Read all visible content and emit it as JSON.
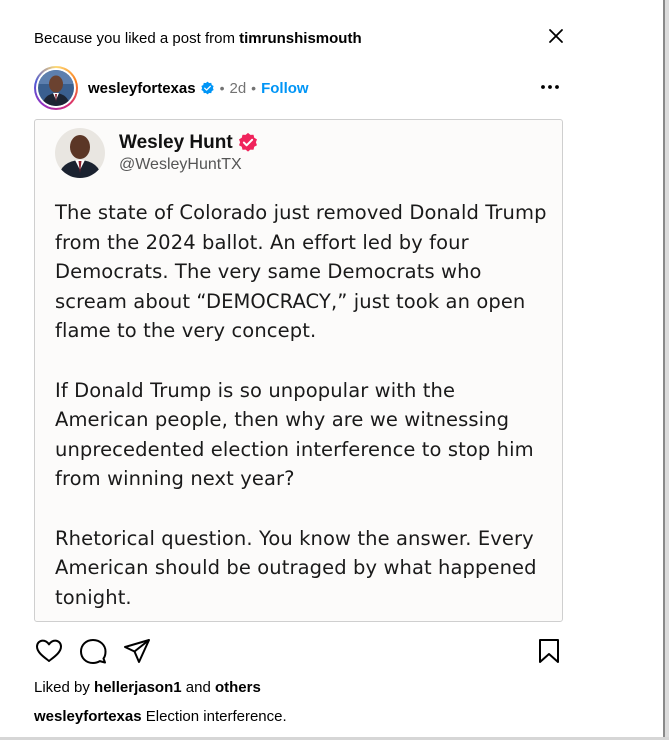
{
  "suggestion": {
    "prefix": "Because you liked a post from ",
    "username": "timrunshismouth"
  },
  "post": {
    "username": "wesleyfortexas",
    "separator": "•",
    "time_ago": "2d",
    "follow_label": "Follow"
  },
  "tweet": {
    "name": "Wesley Hunt",
    "handle": "@WesleyHuntTX",
    "paragraphs": [
      "The state of Colorado just removed Donald Trump from the 2024 ballot. An effort led by four Democrats. The very same Democrats who scream about “DEMOCRACY,” just took an open flame to the very concept.",
      "If Donald Trump is so unpopular with the American people, then why are we witnessing unprecedented election interference to stop him from winning next year?",
      "Rhetorical question. You know the answer. Every American should be outraged by what happened tonight."
    ]
  },
  "likes": {
    "prefix": "Liked by ",
    "user": "hellerjason1",
    "middle": " and ",
    "others": "others"
  },
  "caption": {
    "username": "wesleyfortexas",
    "text": " Election interference."
  },
  "colors": {
    "follow_blue": "#0095f6",
    "verified_blue": "#0095f6",
    "tweet_badge_pink": "#f0245c",
    "muted_gray": "#737373"
  },
  "icons": {
    "close": "close-icon",
    "more": "more-horizontal-icon",
    "like": "heart-icon",
    "comment": "comment-icon",
    "share": "paper-plane-icon",
    "save": "bookmark-icon"
  }
}
